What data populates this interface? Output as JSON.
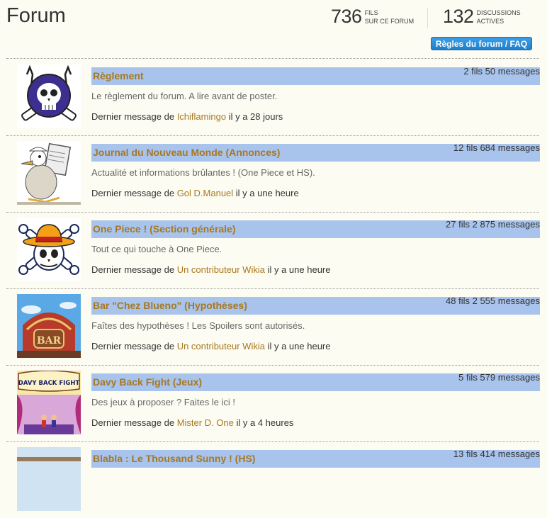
{
  "header": {
    "title": "Forum",
    "threads_count": "736",
    "threads_label_1": "FILS",
    "threads_label_2": "SUR CE FORUM",
    "active_count": "132",
    "active_label_1": "DISCUSSIONS",
    "active_label_2": "ACTIVES",
    "faq_button": "Règles du forum / FAQ"
  },
  "boards": [
    {
      "title": "Règlement",
      "counts": "2 fils 50 messages",
      "description": "Le règlement du forum. A lire avant de poster.",
      "last_prefix": "Dernier message de",
      "last_user": "Ichiflamingo",
      "last_time": "il y a 28 jours",
      "icon": "pirate-skull-icon"
    },
    {
      "title": "Journal du Nouveau Monde (Annonces)",
      "counts": "12 fils 684 messages",
      "description": "Actualité et informations brûlantes ! (One Piece et HS).",
      "last_prefix": "Dernier message de",
      "last_user": "Gol D.Manuel",
      "last_time": "il y a une heure",
      "icon": "news-coo-bird-icon"
    },
    {
      "title": "One Piece ! (Section générale)",
      "counts": "27 fils 2 875 messages",
      "description": "Tout ce qui touche à One Piece.",
      "last_prefix": "Dernier message de",
      "last_user": "Un contributeur Wikia",
      "last_time": "il y a une heure",
      "icon": "strawhat-jolly-roger-icon"
    },
    {
      "title": "Bar \"Chez Blueno\" (Hypothèses)",
      "counts": "48 fils 2 555 messages",
      "description": "Faîtes des hypothèses ! Les Spoilers sont autorisés.",
      "last_prefix": "Dernier message de",
      "last_user": "Un contributeur Wikia",
      "last_time": "il y a une heure",
      "icon": "bar-building-icon",
      "sign": "BAR"
    },
    {
      "title": "Davy Back Fight (Jeux)",
      "counts": "5 fils 579 messages",
      "description": "Des jeux à proposer ? Faites le ici !",
      "last_prefix": "Dernier message de",
      "last_user": "Mister D. One",
      "last_time": "il y a 4 heures",
      "icon": "davy-back-fight-stage-icon",
      "sign": "DAVY BACK FIGHT"
    },
    {
      "title": "Blabla : Le Thousand Sunny ! (HS)",
      "counts": "13 fils 414 messages",
      "description": "",
      "last_prefix": "",
      "last_user": "",
      "last_time": "",
      "icon": "thousand-sunny-icon"
    }
  ]
}
